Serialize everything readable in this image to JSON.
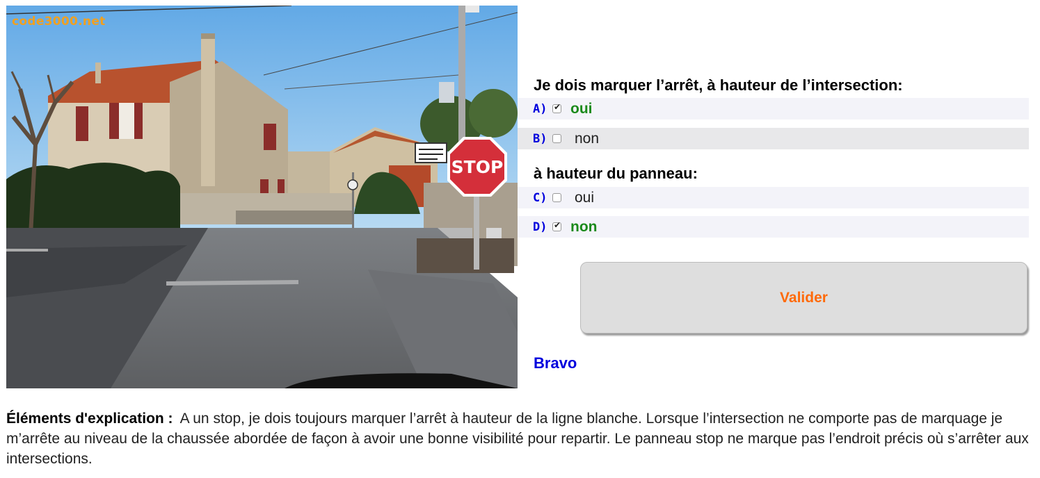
{
  "photo": {
    "watermark": "code3000.net",
    "sign_text": "STOP",
    "sign_color": "#d42f3a"
  },
  "quiz": {
    "question1": "Je dois marquer l’arrêt, à hauteur de l’intersection:",
    "question2": "à hauteur du panneau:",
    "options": [
      {
        "letter": "A)",
        "label": "oui",
        "checked": true
      },
      {
        "letter": "B)",
        "label": "non",
        "checked": false
      },
      {
        "letter": "C)",
        "label": "oui",
        "checked": false
      },
      {
        "letter": "D)",
        "label": "non",
        "checked": true
      }
    ],
    "submit_label": "Valider",
    "result": "Bravo"
  },
  "explanation": {
    "lead": "Éléments d'explication :",
    "text": "A un stop, je dois toujours marquer l’arrêt à hauteur de la ligne blanche. Lorsque l’intersection ne comporte pas de marquage je m’arrête au niveau de la chaussée abordée de façon à avoir une bonne visibilité pour repartir. Le panneau stop ne marque pas l’endroit précis où s’arrêter aux intersections."
  },
  "colors": {
    "accent_blue": "#0000dd",
    "correct_green": "#1b8a1b",
    "button_text": "#ff6a0a"
  }
}
